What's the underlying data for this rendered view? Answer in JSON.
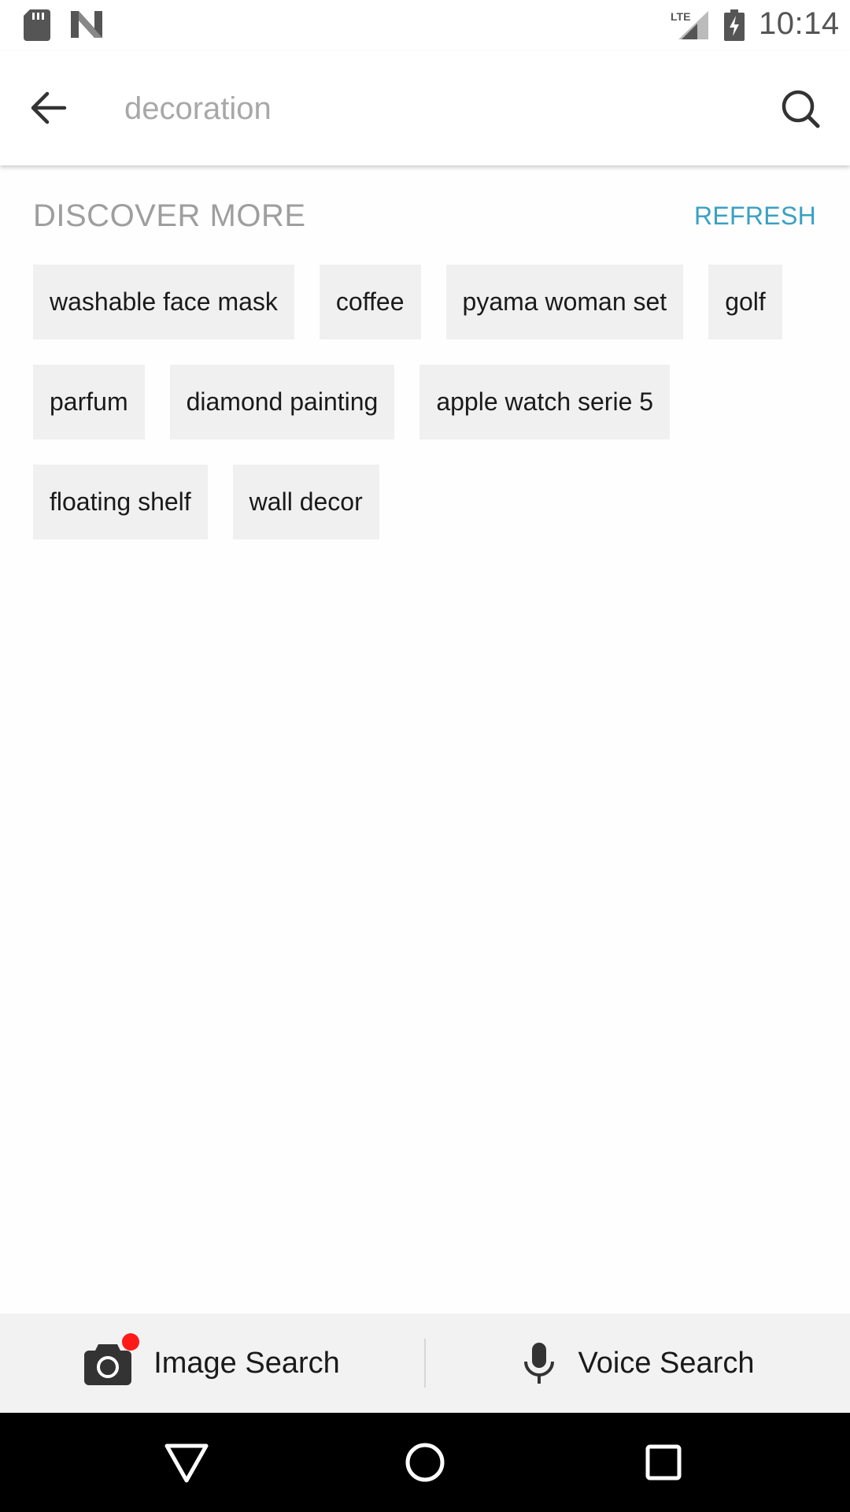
{
  "status_bar": {
    "time": "10:14",
    "network": "LTE",
    "icons": [
      "sd-card-icon",
      "n-notification-icon",
      "lte-signal-icon",
      "battery-charging-icon"
    ]
  },
  "search": {
    "placeholder": "decoration",
    "value": "",
    "back_icon": "arrow-back-icon",
    "search_icon": "search-icon"
  },
  "discover": {
    "title": "DISCOVER MORE",
    "refresh_label": "REFRESH",
    "chips": [
      "washable face mask",
      "coffee",
      "pyama woman set",
      "golf",
      "parfum",
      "diamond painting",
      "apple watch serie 5",
      "floating shelf",
      "wall decor"
    ]
  },
  "bottom_options": {
    "image_search_label": "Image Search",
    "voice_search_label": "Voice Search"
  },
  "colors": {
    "accent": "#3aa0c3",
    "chip_bg": "#f0f0f0",
    "muted_text": "#9e9e9e",
    "notification_dot": "#ff1a1a"
  }
}
